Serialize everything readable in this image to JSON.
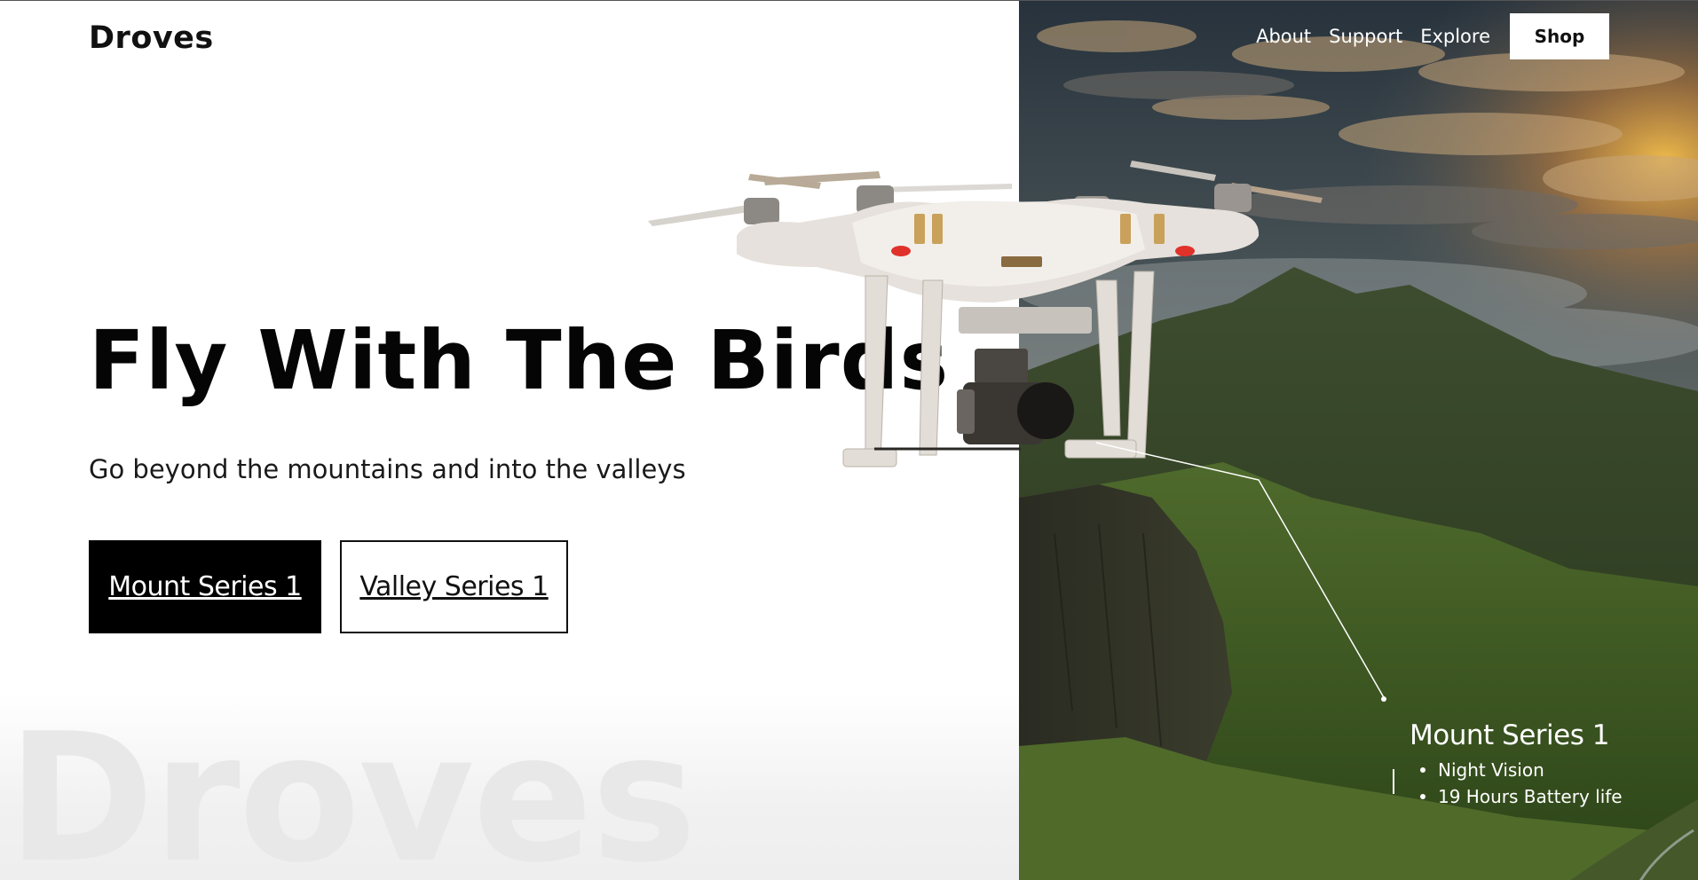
{
  "header": {
    "brand": "Droves",
    "nav": [
      {
        "label": "About"
      },
      {
        "label": "Support"
      },
      {
        "label": "Explore"
      }
    ],
    "shop_label": "Shop"
  },
  "hero": {
    "title": "Fly With The Birds",
    "subtitle": "Go beyond the mountains and into the valleys",
    "primary_button": "Mount Series 1",
    "secondary_button": "Valley Series 1",
    "watermark": "Droves"
  },
  "callout": {
    "title": "Mount Series 1",
    "features": [
      "Night Vision",
      "19 Hours Battery life"
    ]
  },
  "colors": {
    "primary_button_bg": "#000000",
    "shop_button_bg": "#ffffff",
    "drone_accent": "#c9a15a",
    "drone_led": "#e0322a"
  }
}
